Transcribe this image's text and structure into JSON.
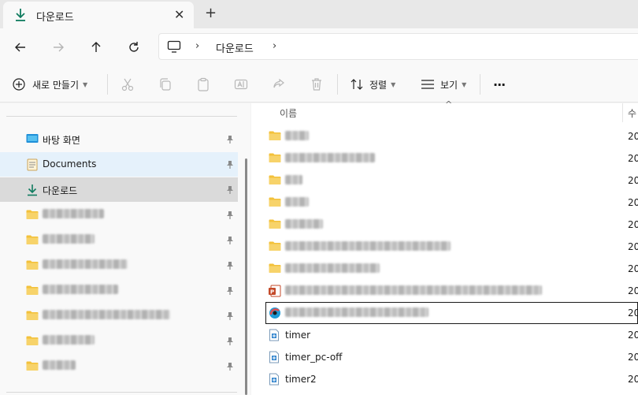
{
  "tab": {
    "title": "다운로드",
    "close_glyph": "✕",
    "new_glyph": "+"
  },
  "address": {
    "separator": "›",
    "crumb": "다운로드",
    "trailing_separator": "›"
  },
  "toolbar": {
    "new_label": "새로 만들기",
    "sort_label": "정렬",
    "view_label": "보기",
    "more_glyph": "···"
  },
  "nav": {
    "items": [
      {
        "label": "바탕 화면",
        "icon": "desktop-icon",
        "pinned": true
      },
      {
        "label": "Documents",
        "icon": "documents-icon",
        "pinned": true,
        "state": "hover"
      },
      {
        "label": "다운로드",
        "icon": "download-icon",
        "pinned": true,
        "state": "selected"
      },
      {
        "label": "",
        "icon": "folder-icon",
        "pinned": true,
        "blurred": true
      },
      {
        "label": "",
        "icon": "folder-icon",
        "pinned": true,
        "blurred": true
      },
      {
        "label": "",
        "icon": "folder-icon",
        "pinned": true,
        "blurred": true
      },
      {
        "label": "",
        "icon": "folder-icon",
        "pinned": true,
        "blurred": true
      },
      {
        "label": "",
        "icon": "folder-icon",
        "pinned": true,
        "blurred": true
      },
      {
        "label": "",
        "icon": "folder-icon",
        "pinned": true,
        "blurred": true
      },
      {
        "label": "",
        "icon": "folder-icon",
        "pinned": true,
        "blurred": true
      }
    ]
  },
  "files": {
    "column_name": "이름",
    "column_date": "수",
    "sort_glyph": "^",
    "rows": [
      {
        "name": "",
        "icon": "folder-icon",
        "blurred": true,
        "date": "20"
      },
      {
        "name": "",
        "icon": "folder-icon",
        "blurred": true,
        "date": "20"
      },
      {
        "name": "",
        "icon": "folder-icon",
        "blurred": true,
        "date": "20"
      },
      {
        "name": "",
        "icon": "folder-icon",
        "blurred": true,
        "date": "20"
      },
      {
        "name": "",
        "icon": "folder-icon",
        "blurred": true,
        "date": "20"
      },
      {
        "name": "",
        "icon": "folder-icon",
        "blurred": true,
        "date": "20"
      },
      {
        "name": "",
        "icon": "folder-icon",
        "blurred": true,
        "date": "20"
      },
      {
        "name": "",
        "icon": "powerpoint-icon",
        "blurred": true,
        "date": "20"
      },
      {
        "name": "",
        "icon": "app-icon",
        "blurred": true,
        "date": "20",
        "focused": true
      },
      {
        "name": "timer",
        "icon": "executable-icon",
        "date": "20"
      },
      {
        "name": "timer_pc-off",
        "icon": "executable-icon",
        "date": "20"
      },
      {
        "name": "timer2",
        "icon": "executable-icon",
        "date": "20"
      }
    ]
  },
  "colors": {
    "accent": "#0f7b5f",
    "folder": "#f3c13a",
    "selected_bg": "#dadada",
    "hover_bg": "#e5f1fb"
  }
}
